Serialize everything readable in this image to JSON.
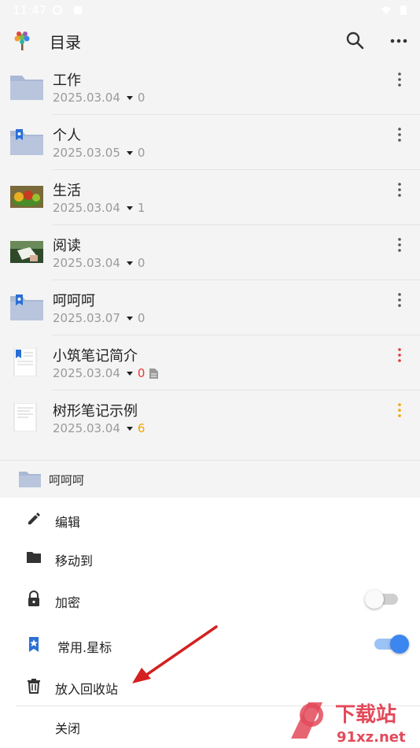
{
  "status": {
    "time": "11:47"
  },
  "appbar": {
    "title": "目录",
    "icons": [
      "tree-logo-icon",
      "search-icon",
      "more-horizontal-icon"
    ]
  },
  "items": [
    {
      "name": "工作",
      "date": "2025.03.04",
      "count": "0",
      "thumb": "folder",
      "count_color": "#9a9a9a",
      "menu_color": "#555555"
    },
    {
      "name": "个人",
      "date": "2025.03.05",
      "count": "0",
      "thumb": "folder-bookmark",
      "count_color": "#9a9a9a",
      "menu_color": "#555555"
    },
    {
      "name": "生活",
      "date": "2025.03.04",
      "count": "1",
      "thumb": "photo-fruit",
      "count_color": "#9a9a9a",
      "menu_color": "#555555"
    },
    {
      "name": "阅读",
      "date": "2025.03.04",
      "count": "0",
      "thumb": "photo-reading",
      "count_color": "#9a9a9a",
      "menu_color": "#555555"
    },
    {
      "name": "呵呵呵",
      "date": "2025.03.07",
      "count": "0",
      "thumb": "folder-bookmark",
      "count_color": "#9a9a9a",
      "menu_color": "#555555"
    },
    {
      "name": "小筑笔记简介",
      "date": "2025.03.04",
      "count": "0",
      "thumb": "doc-bookmark",
      "count_color": "#e53935",
      "menu_color": "#e53935",
      "has_doc_icon": true
    },
    {
      "name": "树形笔记示例",
      "date": "2025.03.04",
      "count": "6",
      "thumb": "doc",
      "count_color": "#f0a500",
      "menu_color": "#f0a500"
    }
  ],
  "sheet": {
    "header_label": "呵呵呵",
    "options": [
      {
        "label": "编辑",
        "icon": "pencil-icon"
      },
      {
        "label": "移动到",
        "icon": "folder-icon"
      },
      {
        "label": "加密",
        "icon": "lock-icon",
        "toggle": false
      },
      {
        "label": "常用.星标",
        "icon": "star-bookmark-icon",
        "toggle": true
      },
      {
        "label": "放入回收站",
        "icon": "trash-icon"
      },
      {
        "label": "关闭",
        "icon": ""
      }
    ]
  },
  "colors": {
    "accent": "#3b86f0",
    "folder": "#a9b8d4",
    "arrow": "#d42020"
  },
  "watermark": {
    "text1": "下载站",
    "text2": "91xz.net"
  }
}
